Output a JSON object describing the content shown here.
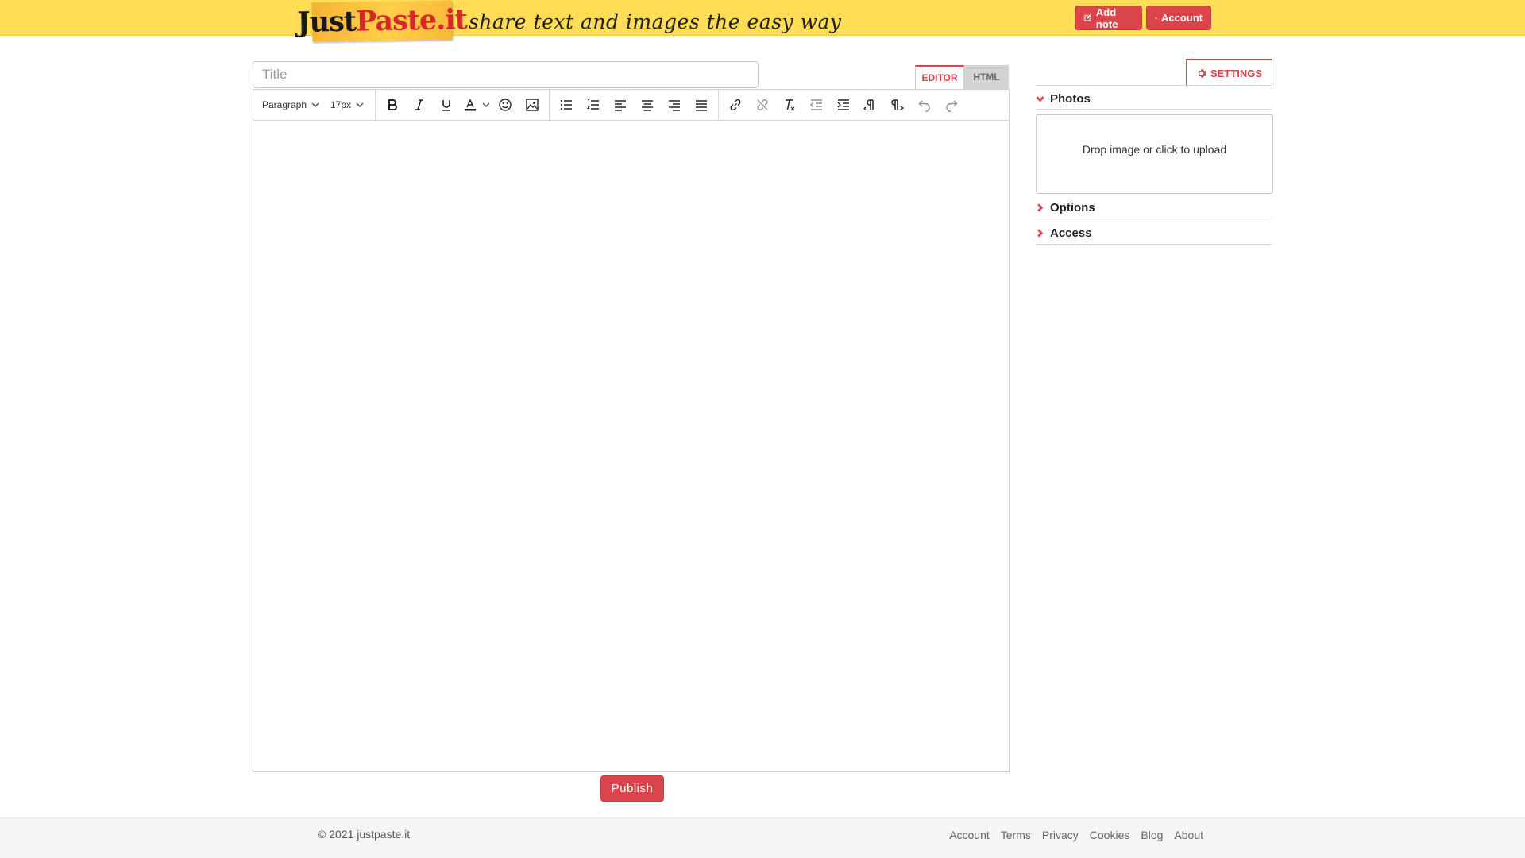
{
  "header": {
    "logo_part1": "Just",
    "logo_part2": "Paste.it",
    "tagline": "share text and images the easy way",
    "add_note_label": "Add note",
    "account_label": "Account",
    "background_color": "#ffdd57",
    "button_color": "#d9454a"
  },
  "editor": {
    "title_placeholder": "Title",
    "title_value": "",
    "tabs": [
      {
        "label": "EDITOR",
        "active": true
      },
      {
        "label": "HTML",
        "active": false
      }
    ],
    "toolbar": {
      "block_format": "Paragraph",
      "font_size": "17px",
      "buttons": [
        "bold-icon",
        "italic-icon",
        "underline-icon",
        "text-color-icon",
        "emoji-icon",
        "image-icon",
        "bullet-list-icon",
        "numbered-list-icon",
        "align-left-icon",
        "align-center-icon",
        "align-right-icon",
        "align-justify-icon",
        "link-icon",
        "unlink-icon",
        "clear-format-icon",
        "outdent-icon",
        "indent-icon",
        "ltr-icon",
        "rtl-icon",
        "undo-icon",
        "redo-icon"
      ]
    },
    "content": "",
    "publish_label": "Publish"
  },
  "settings": {
    "button_label": "SETTINGS",
    "sections": [
      {
        "label": "Photos",
        "expanded": true
      },
      {
        "label": "Options",
        "expanded": false
      },
      {
        "label": "Access",
        "expanded": false
      }
    ],
    "dropzone_text": "Drop image or click to upload"
  },
  "footer": {
    "copyright": "© 2021 justpaste.it",
    "links": [
      "Account",
      "Terms",
      "Privacy",
      "Cookies",
      "Blog",
      "About"
    ]
  }
}
